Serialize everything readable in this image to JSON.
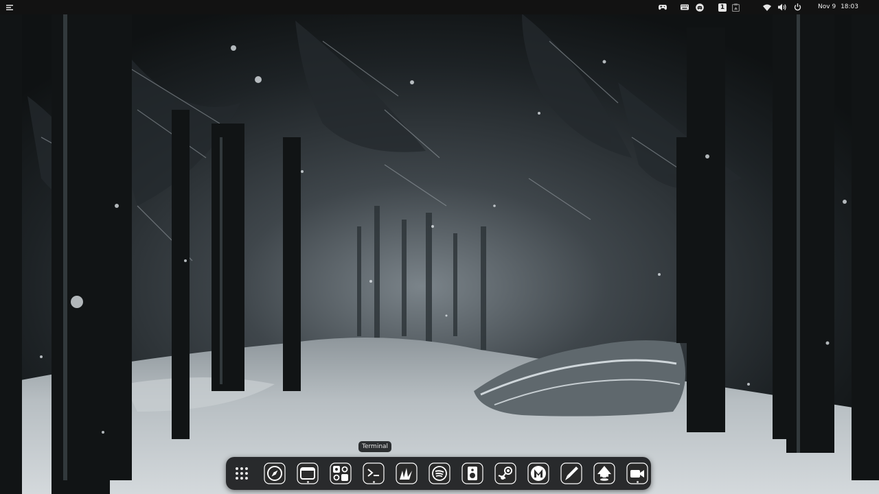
{
  "topbar": {
    "date": "Nov 9",
    "time": "18:03",
    "tray_icons": [
      "gamepad-icon",
      "keyboard-icon",
      "discord-icon",
      "workspace-indicator-icon",
      "clipboard-icon",
      "wifi-icon",
      "volume-icon",
      "power-icon"
    ],
    "workspace_number": "1"
  },
  "dock": {
    "tooltip": "Terminal",
    "apps": [
      {
        "name": "app-grid-icon"
      },
      {
        "name": "web-browser-icon"
      },
      {
        "name": "window-manager-icon"
      },
      {
        "name": "settings-tweaks-icon"
      },
      {
        "name": "terminal-icon"
      },
      {
        "name": "krita-icon"
      },
      {
        "name": "spotify-icon"
      },
      {
        "name": "speaker-app-icon"
      },
      {
        "name": "steam-icon"
      },
      {
        "name": "mail-app-icon"
      },
      {
        "name": "pen-app-icon"
      },
      {
        "name": "inkscape-icon"
      },
      {
        "name": "video-recorder-icon"
      }
    ]
  },
  "colors": {
    "topbar_bg": "#121212",
    "dock_bg": "#1a1b1d",
    "icon_fg": "#ffffff",
    "snow": "#e8eef2"
  }
}
